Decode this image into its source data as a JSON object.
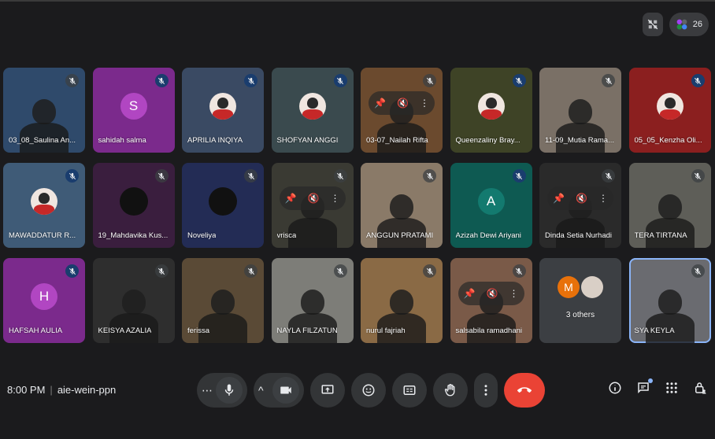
{
  "meeting": {
    "time": "8:00 PM",
    "code": "aie-wein-ppn",
    "participant_count": "26"
  },
  "colors": {
    "accent": "#8ab4f8",
    "hangup": "#ea4335"
  },
  "tiles": [
    {
      "name": "03_08_Saulina An...",
      "bg": "#2f4a6b",
      "type": "video"
    },
    {
      "name": "sahidah salma",
      "bg": "#7b2a8c",
      "type": "letter",
      "letter": "S",
      "letter_bg": "#b146c2"
    },
    {
      "name": "APRILIA INQIYA",
      "bg": "#3a4a63",
      "type": "photo"
    },
    {
      "name": "SHOFYAN ANGGI",
      "bg": "#3a4a4e",
      "type": "photo"
    },
    {
      "name": "03-07_Nailah Rifta",
      "bg": "#6b4a2e",
      "type": "hover"
    },
    {
      "name": "Queenzaliny Bray...",
      "bg": "#3e4326",
      "type": "photo"
    },
    {
      "name": "11-09_Mutia Rama...",
      "bg": "#7a7066",
      "type": "video"
    },
    {
      "name": "05_05_Kenzha Oli...",
      "bg": "#8b1f1f",
      "type": "photo"
    },
    {
      "name": "MAWADDATUR R...",
      "bg": "#3f5b77",
      "type": "photo"
    },
    {
      "name": "19_Mahdavika Kus...",
      "bg": "#3a1e3e",
      "type": "dark-circle"
    },
    {
      "name": "Noveliya",
      "bg": "#232c55",
      "type": "dark-circle"
    },
    {
      "name": "vrisca",
      "bg": "#3a3a33",
      "type": "hover"
    },
    {
      "name": "ANGGUN PRATAMI",
      "bg": "#8a7a68",
      "type": "video"
    },
    {
      "name": "Azizah Dewi Ariyani",
      "bg": "#0e5a52",
      "type": "letter",
      "letter": "A",
      "letter_bg": "#137a6f"
    },
    {
      "name": "Dinda Setia Nurhadi",
      "bg": "#2a2a2a",
      "type": "hover"
    },
    {
      "name": "TERA TIRTANA",
      "bg": "#5e5e58",
      "type": "video"
    },
    {
      "name": "HAFSAH AULIA",
      "bg": "#7b2a8c",
      "type": "letter",
      "letter": "H",
      "letter_bg": "#b146c2"
    },
    {
      "name": "KEISYA AZALIA",
      "bg": "#2e2e2e",
      "type": "video"
    },
    {
      "name": "ferissa",
      "bg": "#5a4a36",
      "type": "video"
    },
    {
      "name": "NAYLA FILZATUN",
      "bg": "#7d7d78",
      "type": "video"
    },
    {
      "name": "nurul fajriah",
      "bg": "#8a6a45",
      "type": "video"
    },
    {
      "name": "salsabila ramadhani",
      "bg": "#7a5a48",
      "type": "hover"
    },
    {
      "name": "3 others",
      "bg": "#3c3f43",
      "type": "others",
      "letter": "M"
    },
    {
      "name": "SYA KEYLA",
      "bg": "#6a6b70",
      "type": "video",
      "selected": true
    }
  ]
}
